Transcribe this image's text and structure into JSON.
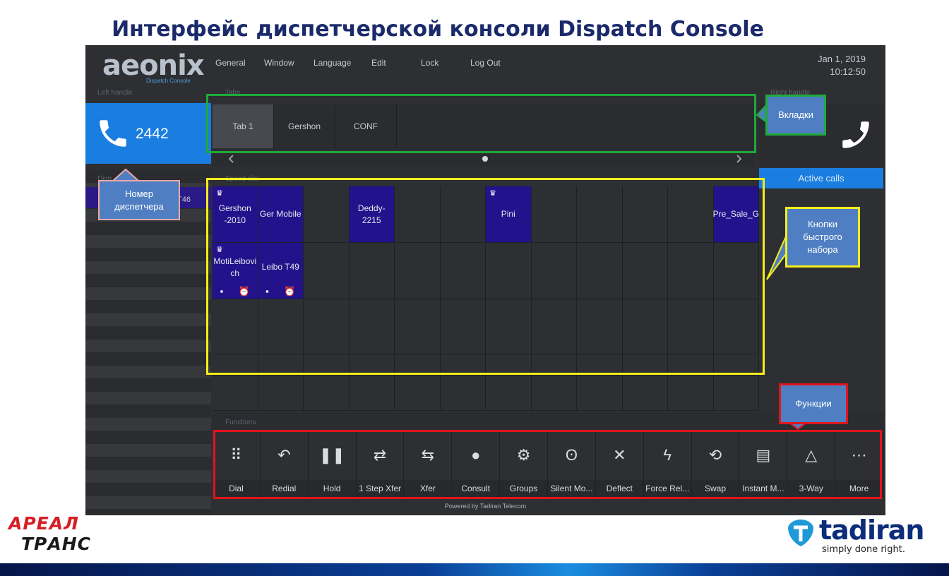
{
  "slide": {
    "title": "Интерфейс диспетчерской консоли Dispatch Console",
    "logo_left_top": "АРЕАЛ",
    "logo_left_bottom": "ТРАНС",
    "logo_right": "tadiran",
    "logo_right_tagline": "simply done right."
  },
  "app": {
    "logo": "aeonix",
    "logo_subtitle": "Dispatch Console",
    "menu": [
      "General",
      "Window",
      "Language",
      "Edit",
      "Lock",
      "Log Out"
    ],
    "date": "Jan 1, 2019",
    "time": "10:12:50",
    "powered_by": "Powered by Tadiran Telecom"
  },
  "left_handle": {
    "label": "Left handle",
    "number": "2442",
    "dispatchers_label": "Disp",
    "dispatcher_row_text": "T46"
  },
  "tabs": {
    "label": "Tabs",
    "items": [
      "Tab 1",
      "Gershon",
      "CONF"
    ],
    "active_index": 0
  },
  "right_handle": {
    "label": "Right handle",
    "active_calls": "Active calls"
  },
  "speed_dial": {
    "label": "Speed dial",
    "cells": [
      {
        "col": 1,
        "row": 1,
        "text": "Gershon -2010",
        "crown": true,
        "icons": false
      },
      {
        "col": 2,
        "row": 1,
        "text": "Ger Mobile",
        "crown": false,
        "icons": false
      },
      {
        "col": 4,
        "row": 1,
        "text": "Deddy-2215",
        "crown": false,
        "icons": false
      },
      {
        "col": 7,
        "row": 1,
        "text": "Pini",
        "crown": true,
        "icons": false
      },
      {
        "col": 12,
        "row": 1,
        "text": "Pre_Sale_G",
        "crown": false,
        "icons": false
      },
      {
        "col": 1,
        "row": 2,
        "text": "MotiLeibovi ch",
        "crown": true,
        "icons": true
      },
      {
        "col": 2,
        "row": 2,
        "text": "Leibo T49",
        "crown": false,
        "icons": true
      }
    ]
  },
  "functions": {
    "label": "Functions",
    "items": [
      {
        "label": "Dial",
        "icon": "dialpad-icon",
        "glyph": "⠿"
      },
      {
        "label": "Redial",
        "icon": "redial-icon",
        "glyph": "↶"
      },
      {
        "label": "Hold",
        "icon": "pause-icon",
        "glyph": "❚❚"
      },
      {
        "label": "1 Step Xfer",
        "icon": "one-step-transfer-icon",
        "glyph": "⇄"
      },
      {
        "label": "Xfer",
        "icon": "transfer-icon",
        "glyph": "⇆"
      },
      {
        "label": "Consult",
        "icon": "chat-bubble-icon",
        "glyph": "●"
      },
      {
        "label": "Groups",
        "icon": "gear-icon",
        "glyph": "⚙"
      },
      {
        "label": "Silent Mo...",
        "icon": "ear-icon",
        "glyph": "ʘ"
      },
      {
        "label": "Deflect",
        "icon": "deflect-icon",
        "glyph": "✕"
      },
      {
        "label": "Force Rel...",
        "icon": "force-release-icon",
        "glyph": "ϟ"
      },
      {
        "label": "Swap",
        "icon": "swap-icon",
        "glyph": "⟲"
      },
      {
        "label": "Instant M...",
        "icon": "instant-message-icon",
        "glyph": "▤"
      },
      {
        "label": "3-Way",
        "icon": "three-way-icon",
        "glyph": "△"
      },
      {
        "label": "More",
        "icon": "more-icon",
        "glyph": "⋯"
      }
    ]
  },
  "callouts": {
    "tabs": "Вкладки",
    "dispatcher_number": "Номер диспетчера",
    "speed_dial": "Кнопки быстрого набора",
    "functions": "Функции"
  },
  "colors": {
    "title": "#1b2a6b",
    "console_bg": "#2d2f33",
    "accent_blue": "#1a7de0",
    "speed_dial_filled": "#24128c",
    "highlight_green": "#1faa3a",
    "highlight_yellow": "#f5ee1a",
    "highlight_red": "#e1141c",
    "callout_fill": "#4f7fc2"
  }
}
